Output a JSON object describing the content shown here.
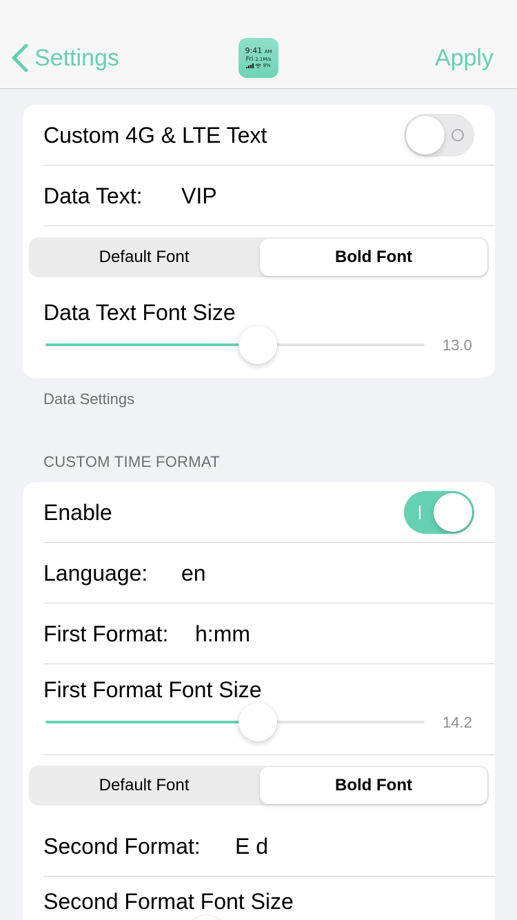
{
  "nav": {
    "back_label": "Settings",
    "apply_label": "Apply",
    "app_icon": {
      "time": "9:41",
      "ampm": "AM",
      "day": "Fri",
      "speed": "2.1M/s",
      "battery": "9%"
    }
  },
  "data_section": {
    "custom_lte": {
      "label": "Custom 4G & LTE Text",
      "enabled": false
    },
    "data_text": {
      "label": "Data Text:",
      "value": "VIP"
    },
    "font_style": {
      "options": [
        "Default Font",
        "Bold Font"
      ],
      "selected": "Bold Font"
    },
    "font_size": {
      "label": "Data Text Font Size",
      "value_text": "13.0",
      "fraction": 0.56
    },
    "footer": "Data Settings"
  },
  "time_section": {
    "header": "CUSTOM TIME FORMAT",
    "enable": {
      "label": "Enable",
      "enabled": true
    },
    "language": {
      "label": "Language:",
      "value": "en"
    },
    "first_format": {
      "label": "First Format:",
      "value": "h:mm"
    },
    "first_font_size": {
      "label": "First Format Font Size",
      "value_text": "14.2",
      "fraction": 0.56
    },
    "font_style": {
      "options": [
        "Default Font",
        "Bold Font"
      ],
      "selected": "Bold Font"
    },
    "second_format": {
      "label": "Second Format:",
      "value": "E d"
    },
    "second_font_size": {
      "label": "Second Format Font Size"
    }
  },
  "colors": {
    "accent": "#66d1b2",
    "background": "#f1f2f6",
    "card": "#ffffff",
    "secondary_text": "#6d6d72"
  },
  "icons": [
    "chevron-left-icon",
    "app-icon",
    "toggle-off-icon",
    "toggle-on-icon",
    "signal-icon",
    "wifi-icon"
  ]
}
